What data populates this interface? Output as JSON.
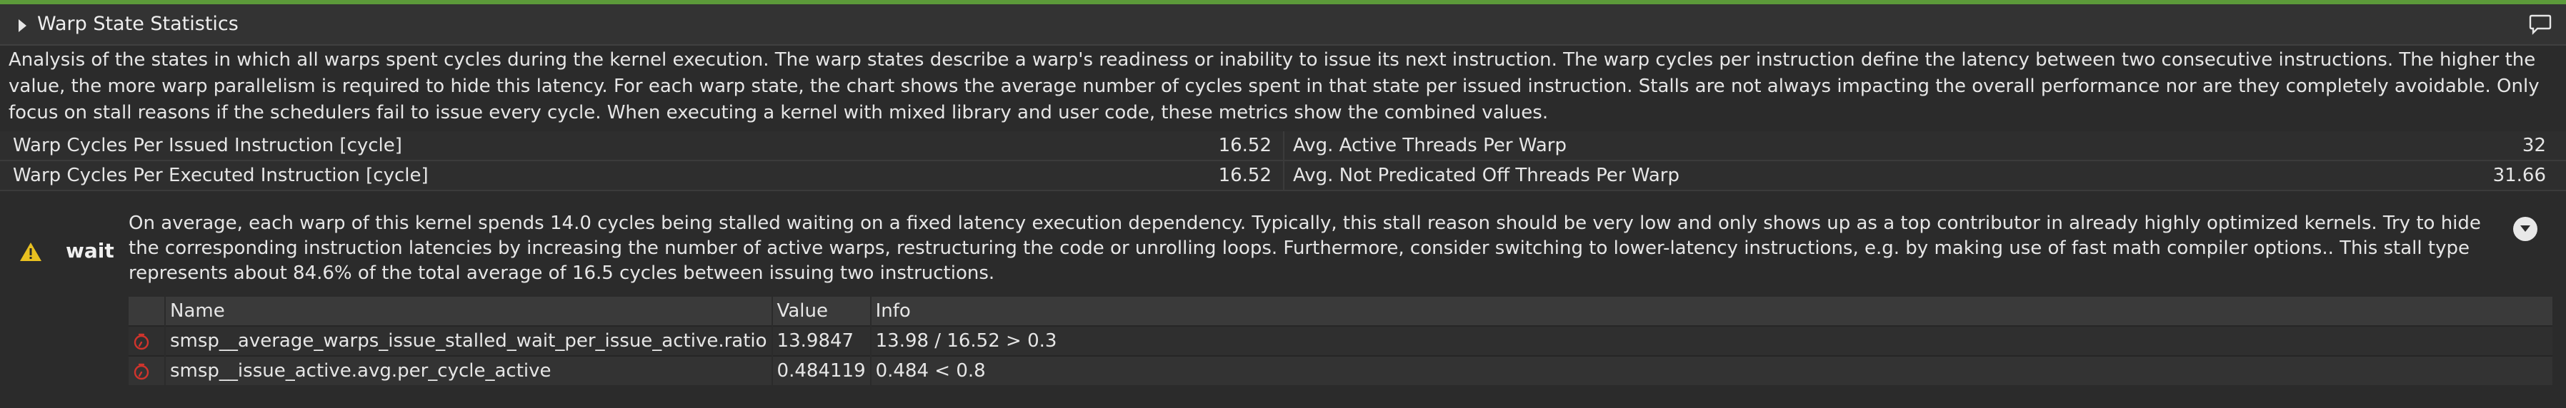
{
  "section": {
    "title": "Warp State Statistics",
    "description": "Analysis of the states in which all warps spent cycles during the kernel execution. The warp states describe a warp's readiness or inability to issue its next instruction. The warp cycles per instruction define the latency between two consecutive instructions. The higher the value, the more warp parallelism is required to hide this latency. For each warp state, the chart shows the average number of cycles spent in that state per issued instruction. Stalls are not always impacting the overall performance nor are they completely avoidable. Only focus on stall reasons if the schedulers fail to issue every cycle. When executing a kernel with mixed library and user code, these metrics show the combined values."
  },
  "icons": {
    "header": "comment-icon",
    "warning": "warning-icon",
    "expand": "chevron-down-icon",
    "rule": "stopwatch-icon"
  },
  "colors": {
    "accent": "#5c9a3a",
    "warning": "#e8c020",
    "rule_icon": "#d0342c",
    "background": "#2b2b2b"
  },
  "metrics": [
    {
      "left_name": "Warp Cycles Per Issued Instruction [cycle]",
      "left_value": "16.52",
      "right_name": "Avg. Active Threads Per Warp",
      "right_value": "32"
    },
    {
      "left_name": "Warp Cycles Per Executed Instruction [cycle]",
      "left_value": "16.52",
      "right_name": "Avg. Not Predicated Off Threads Per Warp",
      "right_value": "31.66"
    }
  ],
  "warning": {
    "label": "wait",
    "text": "On average, each warp of this kernel spends 14.0 cycles being stalled waiting on a fixed latency execution dependency. Typically, this stall reason should be very low and only shows up as a top contributor in already highly optimized kernels. Try to hide the corresponding instruction latencies by increasing the number of active warps, restructuring the code or unrolling loops. Furthermore, consider switching to lower-latency instructions, e.g. by making use of fast math compiler options.. This stall type represents about 84.6% of the total average of 16.5 cycles between issuing two instructions."
  },
  "rules_table": {
    "headers": {
      "name": "Name",
      "value": "Value",
      "info": "Info"
    },
    "rows": [
      {
        "name": "smsp__average_warps_issue_stalled_wait_per_issue_active.ratio",
        "value": "13.9847",
        "info": "13.98 / 16.52 > 0.3"
      },
      {
        "name": "smsp__issue_active.avg.per_cycle_active",
        "value": "0.484119",
        "info": "0.484 < 0.8"
      }
    ]
  }
}
